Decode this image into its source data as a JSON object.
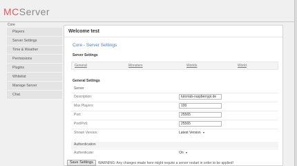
{
  "logo": {
    "mc": "MC",
    "server": "Server"
  },
  "sidebar": {
    "header": "Core",
    "items": [
      {
        "label": "Players"
      },
      {
        "label": "Server Settings"
      },
      {
        "label": "Time & Weather"
      },
      {
        "label": "Permissions"
      },
      {
        "label": "Plugins"
      },
      {
        "label": "Whitelist"
      },
      {
        "label": "Manage Server"
      },
      {
        "label": "Chat"
      }
    ]
  },
  "main": {
    "welcome": "Welcome test",
    "core_title": "Core - Server Settings",
    "server_settings_label": "Server Settings",
    "tabs": [
      {
        "label": "General"
      },
      {
        "label": "Monsters"
      },
      {
        "label": "Worlds"
      },
      {
        "label": "World"
      }
    ],
    "general_settings_label": "General Settings",
    "server_group_label": "Server",
    "fields": {
      "description": {
        "label": "Description:",
        "value": "tutorials-raspberrypi.de"
      },
      "max_players": {
        "label": "Max Players:",
        "value": "100"
      },
      "port": {
        "label": "Port:",
        "value": "25565"
      },
      "port_ipv6": {
        "label": "PortIPv6:",
        "value": "25565"
      },
      "shown_version": {
        "label": "Shown Version:",
        "value": "Latest Version"
      }
    },
    "authentication_label": "Authentication",
    "authenticate": {
      "label": "Authenticate:",
      "value": "On"
    }
  },
  "footer": {
    "save_label": "Save Settings",
    "warning": "WARNING: Any changes made here might require a server restart in order to be applied!"
  }
}
